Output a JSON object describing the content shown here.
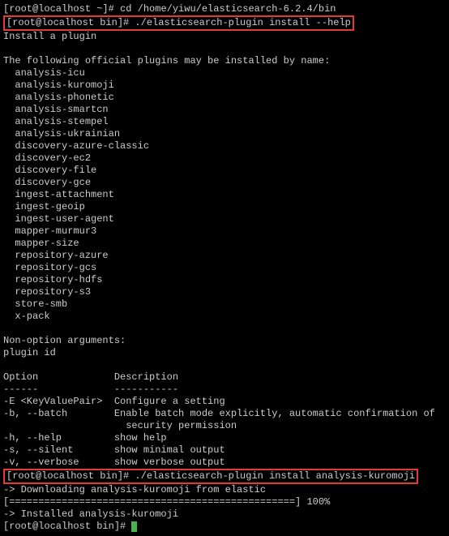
{
  "lines": {
    "cd_prompt": "[root@localhost ~]# ",
    "cd_cmd": "cd /home/yiwu/elasticsearch-6.2.4/bin",
    "help_prompt": "[root@localhost bin]#",
    "help_cmd": " ./elasticsearch-plugin install --help",
    "install_title": "Install a plugin",
    "plugins_header": "The following official plugins may be installed by name:",
    "plugins": [
      "analysis-icu",
      "analysis-kuromoji",
      "analysis-phonetic",
      "analysis-smartcn",
      "analysis-stempel",
      "analysis-ukrainian",
      "discovery-azure-classic",
      "discovery-ec2",
      "discovery-file",
      "discovery-gce",
      "ingest-attachment",
      "ingest-geoip",
      "ingest-user-agent",
      "mapper-murmur3",
      "mapper-size",
      "repository-azure",
      "repository-gcs",
      "repository-hdfs",
      "repository-s3",
      "store-smb",
      "x-pack"
    ],
    "nonopt_header": "Non-option arguments:",
    "nonopt_arg": "plugin id",
    "option_header_col1": "Option",
    "option_header_col2": "Description",
    "option_sep_col1": "------",
    "option_sep_col2": "-----------",
    "opts": [
      {
        "flag": "-E <KeyValuePair>",
        "desc": "Configure a setting"
      },
      {
        "flag": "-b, --batch",
        "desc": "Enable batch mode explicitly, automatic confirmation of"
      },
      {
        "flag": "",
        "desc": "  security permission"
      },
      {
        "flag": "-h, --help",
        "desc": "show help"
      },
      {
        "flag": "-s, --silent",
        "desc": "show minimal output"
      },
      {
        "flag": "-v, --verbose",
        "desc": "show verbose output"
      }
    ],
    "run_prompt": "[root@localhost bin]#",
    "run_cmd": " ./elasticsearch-plugin install analysis-kuromoji",
    "download": "-> Downloading analysis-kuromoji from elastic",
    "progress_bar": "[=================================================] 100%",
    "installed": "-> Installed analysis-kuromoji",
    "final_prompt": "[root@localhost bin]# "
  }
}
